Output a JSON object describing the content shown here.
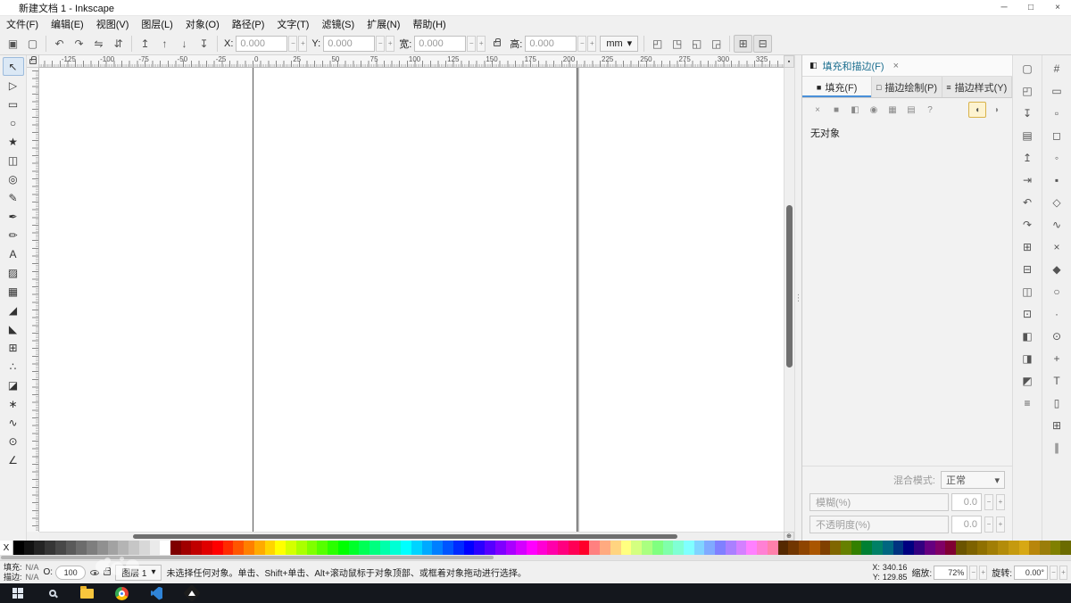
{
  "window": {
    "title": "新建文档 1 - Inkscape",
    "controls": {
      "minimize": "─",
      "maximize": "□",
      "close": "×"
    }
  },
  "icons": {
    "close": "×",
    "caret_down": "▾",
    "minus": "−",
    "plus": "+",
    "splitter": "⋮",
    "no_color": "X",
    "sticky_zoom": "▪",
    "corner_zoom": "⊕"
  },
  "menubar": {
    "items": [
      {
        "name": "menu-file",
        "label": "文件(F)"
      },
      {
        "name": "menu-edit",
        "label": "编辑(E)"
      },
      {
        "name": "menu-view",
        "label": "视图(V)"
      },
      {
        "name": "menu-layer",
        "label": "图层(L)"
      },
      {
        "name": "menu-object",
        "label": "对象(O)"
      },
      {
        "name": "menu-path",
        "label": "路径(P)"
      },
      {
        "name": "menu-text",
        "label": "文字(T)"
      },
      {
        "name": "menu-filters",
        "label": "滤镜(S)"
      },
      {
        "name": "menu-extensions",
        "label": "扩展(N)"
      },
      {
        "name": "menu-help",
        "label": "帮助(H)"
      }
    ]
  },
  "cmdbar": {
    "select_buttons": [
      {
        "name": "select-all-button",
        "glyph": "▣"
      },
      {
        "name": "deselect-button",
        "glyph": "▢"
      }
    ],
    "transform_buttons": [
      {
        "name": "rotate-ccw-button",
        "glyph": "↶"
      },
      {
        "name": "rotate-cw-button",
        "glyph": "↷"
      },
      {
        "name": "flip-horizontal-button",
        "glyph": "⇋"
      },
      {
        "name": "flip-vertical-button",
        "glyph": "⇵"
      }
    ],
    "zorder_buttons": [
      {
        "name": "raise-to-top-button",
        "glyph": "↥"
      },
      {
        "name": "raise-button",
        "glyph": "↑"
      },
      {
        "name": "lower-button",
        "glyph": "↓"
      },
      {
        "name": "lower-to-bottom-button",
        "glyph": "↧"
      }
    ],
    "x_label": "X:",
    "x_value": "0.000",
    "y_label": "Y:",
    "y_value": "0.000",
    "w_label": "宽:",
    "w_value": "0.000",
    "h_label": "高:",
    "h_value": "0.000",
    "unit": "mm",
    "affect_buttons": [
      {
        "name": "stroke-transform-toggle",
        "glyph": "◰"
      },
      {
        "name": "corners-transform-toggle",
        "glyph": "◳"
      },
      {
        "name": "gradient-transform-toggle",
        "glyph": "◱"
      },
      {
        "name": "pattern-transform-toggle",
        "glyph": "◲"
      }
    ],
    "bbox_buttons": [
      {
        "name": "geometric-bbox-toggle",
        "glyph": "⊞"
      },
      {
        "name": "visual-bbox-toggle",
        "glyph": "⊟"
      }
    ]
  },
  "toolbox": {
    "tools": [
      {
        "name": "selector-tool",
        "glyph": "↖",
        "active": true
      },
      {
        "name": "node-tool",
        "glyph": "▷"
      },
      {
        "name": "rectangle-tool",
        "glyph": "▭"
      },
      {
        "name": "ellipse-tool",
        "glyph": "○"
      },
      {
        "name": "star-tool",
        "glyph": "★"
      },
      {
        "name": "box3d-tool",
        "glyph": "◫"
      },
      {
        "name": "spiral-tool",
        "glyph": "◎"
      },
      {
        "name": "pencil-tool",
        "glyph": "✎"
      },
      {
        "name": "pen-tool",
        "glyph": "✒"
      },
      {
        "name": "calligraphy-tool",
        "glyph": "✏"
      },
      {
        "name": "text-tool",
        "glyph": "A"
      },
      {
        "name": "gradient-tool",
        "glyph": "▨"
      },
      {
        "name": "mesh-tool",
        "glyph": "▦"
      },
      {
        "name": "dropper-tool",
        "glyph": "◢"
      },
      {
        "name": "paint-bucket-tool",
        "glyph": "◣"
      },
      {
        "name": "connector-tool",
        "glyph": "⊞"
      },
      {
        "name": "spray-tool",
        "glyph": "∴"
      },
      {
        "name": "eraser-tool",
        "glyph": "◪"
      },
      {
        "name": "tweak-tool",
        "glyph": "∗"
      },
      {
        "name": "lpe-tool",
        "glyph": "∿"
      },
      {
        "name": "zoom-tool",
        "glyph": "⊙"
      },
      {
        "name": "measure-tool",
        "glyph": "∠"
      }
    ]
  },
  "rulers": {
    "horizontal_labels": [
      -125,
      -100,
      -75,
      -50,
      -25,
      0,
      25,
      50,
      75,
      100,
      125,
      150,
      175,
      200,
      225,
      250,
      275,
      300,
      325
    ]
  },
  "dock": {
    "header_icon": "◧",
    "title": "填充和描边(F)",
    "tabs": [
      {
        "name": "tab-fill",
        "glyph": "■",
        "label": "填充(F)",
        "active": true
      },
      {
        "name": "tab-stroke-paint",
        "glyph": "□",
        "label": "描边绘制(P)"
      },
      {
        "name": "tab-stroke-style",
        "glyph": "≡",
        "label": "描边样式(Y)"
      }
    ],
    "fill_types": [
      {
        "name": "no-paint-button",
        "glyph": "×"
      },
      {
        "name": "flat-color-button",
        "glyph": "■"
      },
      {
        "name": "linear-gradient-button",
        "glyph": "◧"
      },
      {
        "name": "radial-gradient-button",
        "glyph": "◉"
      },
      {
        "name": "pattern-button",
        "glyph": "▦"
      },
      {
        "name": "swatch-button",
        "glyph": "▤"
      },
      {
        "name": "unknown-paint-button",
        "glyph": "?"
      }
    ],
    "fill_rules": [
      {
        "name": "fill-rule-evenodd-button",
        "glyph": "◖",
        "active": true
      },
      {
        "name": "fill-rule-nonzero-button",
        "glyph": "◗"
      }
    ],
    "no_object_label": "无对象",
    "blend_label": "混合模式:",
    "blend_value": "正常",
    "blur_label": "模糊(%)",
    "blur_value": "0.0",
    "opacity_label": "不透明度(%)",
    "opacity_value": "0.0"
  },
  "right_toolbars": {
    "commands": [
      {
        "name": "new-document-button",
        "glyph": "▢"
      },
      {
        "name": "open-document-button",
        "glyph": "◰"
      },
      {
        "name": "save-button",
        "glyph": "↧"
      },
      {
        "name": "print-button",
        "glyph": "▤"
      },
      {
        "name": "import-button",
        "glyph": "↥"
      },
      {
        "name": "export-button",
        "glyph": "⇥"
      },
      {
        "name": "undo-button",
        "glyph": "↶"
      },
      {
        "name": "redo-button",
        "glyph": "↷"
      },
      {
        "name": "copy-button",
        "glyph": "⊞"
      },
      {
        "name": "paste-button",
        "glyph": "⊟"
      },
      {
        "name": "duplicate-button",
        "glyph": "◫"
      },
      {
        "name": "zoom-page-button",
        "glyph": "⊡"
      },
      {
        "name": "group-button",
        "glyph": "◧"
      },
      {
        "name": "ungroup-button",
        "glyph": "◨"
      },
      {
        "name": "fill-stroke-dialog-button",
        "glyph": "◩"
      },
      {
        "name": "preferences-button",
        "glyph": "≡"
      }
    ],
    "snap": [
      {
        "name": "snap-enable-toggle",
        "glyph": "#"
      },
      {
        "name": "snap-bbox-toggle",
        "glyph": "▭"
      },
      {
        "name": "snap-bbox-edges-toggle",
        "glyph": "▫"
      },
      {
        "name": "snap-bbox-corners-toggle",
        "glyph": "◻"
      },
      {
        "name": "snap-bbox-midpoints-toggle",
        "glyph": "◦"
      },
      {
        "name": "snap-bbox-centers-toggle",
        "glyph": "▪"
      },
      {
        "name": "snap-nodes-toggle",
        "glyph": "◇"
      },
      {
        "name": "snap-paths-toggle",
        "glyph": "∿"
      },
      {
        "name": "snap-intersections-toggle",
        "glyph": "×"
      },
      {
        "name": "snap-cusp-nodes-toggle",
        "glyph": "◆"
      },
      {
        "name": "snap-smooth-nodes-toggle",
        "glyph": "○"
      },
      {
        "name": "snap-midpoints-toggle",
        "glyph": "·"
      },
      {
        "name": "snap-centers-toggle",
        "glyph": "⊙"
      },
      {
        "name": "snap-rotation-center-toggle",
        "glyph": "+"
      },
      {
        "name": "snap-text-baseline-toggle",
        "glyph": "T"
      },
      {
        "name": "snap-page-border-toggle",
        "glyph": "▯"
      },
      {
        "name": "snap-grid-toggle",
        "glyph": "⊞"
      },
      {
        "name": "snap-guides-toggle",
        "glyph": "∥"
      }
    ]
  },
  "palette": {
    "colors": [
      "#000000",
      "#121212",
      "#242424",
      "#363636",
      "#484848",
      "#5a5a5a",
      "#6c6c6c",
      "#7e7e7e",
      "#909090",
      "#a2a2a2",
      "#b4b4b4",
      "#c6c6c6",
      "#d8d8d8",
      "#eaeaea",
      "#ffffff",
      "#7f0000",
      "#a00000",
      "#c00000",
      "#e00000",
      "#ff0000",
      "#ff2a00",
      "#ff5500",
      "#ff7f00",
      "#ffaa00",
      "#ffd400",
      "#ffff00",
      "#d4ff00",
      "#aaff00",
      "#7fff00",
      "#55ff00",
      "#2aff00",
      "#00ff00",
      "#00ff2a",
      "#00ff55",
      "#00ff7f",
      "#00ffaa",
      "#00ffd4",
      "#00ffff",
      "#00d4ff",
      "#00aaff",
      "#007fff",
      "#0055ff",
      "#002aff",
      "#0000ff",
      "#2a00ff",
      "#5500ff",
      "#7f00ff",
      "#aa00ff",
      "#d400ff",
      "#ff00ff",
      "#ff00d4",
      "#ff00aa",
      "#ff007f",
      "#ff0055",
      "#ff002a",
      "#ff8080",
      "#ffaa80",
      "#ffd480",
      "#ffff80",
      "#d4ff80",
      "#aaff80",
      "#80ff80",
      "#80ffaa",
      "#80ffd4",
      "#80ffff",
      "#80d4ff",
      "#80aaff",
      "#8080ff",
      "#aa80ff",
      "#d480ff",
      "#ff80ff",
      "#ff80d4",
      "#ff80aa",
      "#552900",
      "#713600",
      "#8e4400",
      "#aa5500",
      "#804000",
      "#806600",
      "#668000",
      "#338000",
      "#008033",
      "#008066",
      "#006680",
      "#003380",
      "#000080",
      "#330080",
      "#660080",
      "#800066",
      "#800033",
      "#6b5400",
      "#7d6200",
      "#8f7000",
      "#a17e05",
      "#b38c0a",
      "#c59a0f",
      "#d7a814",
      "#b8860b",
      "#9a7d0a",
      "#808000",
      "#6b6b00"
    ]
  },
  "statusbar": {
    "fill_label": "填充:",
    "fill_value": "N/A",
    "stroke_label": "描边:",
    "stroke_value": "N/A",
    "opacity_label": "O:",
    "opacity_value": "100",
    "layer_label": "图层 1",
    "message": "未选择任何对象。单击、Shift+单击、Alt+滚动鼠标于对象顶部、或框着对象拖动进行选择。",
    "x_label": "X:",
    "x_value": "340.16",
    "y_label": "Y:",
    "y_value": "129.85",
    "zoom_label": "缩放:",
    "zoom_value": "72%",
    "rotation_label": "旋转:",
    "rotation_value": "0.00°"
  },
  "taskbar": {
    "items": [
      "start-button",
      "search-button",
      "file-explorer-button",
      "chrome-button",
      "vscode-button",
      "inkscape-button"
    ]
  }
}
